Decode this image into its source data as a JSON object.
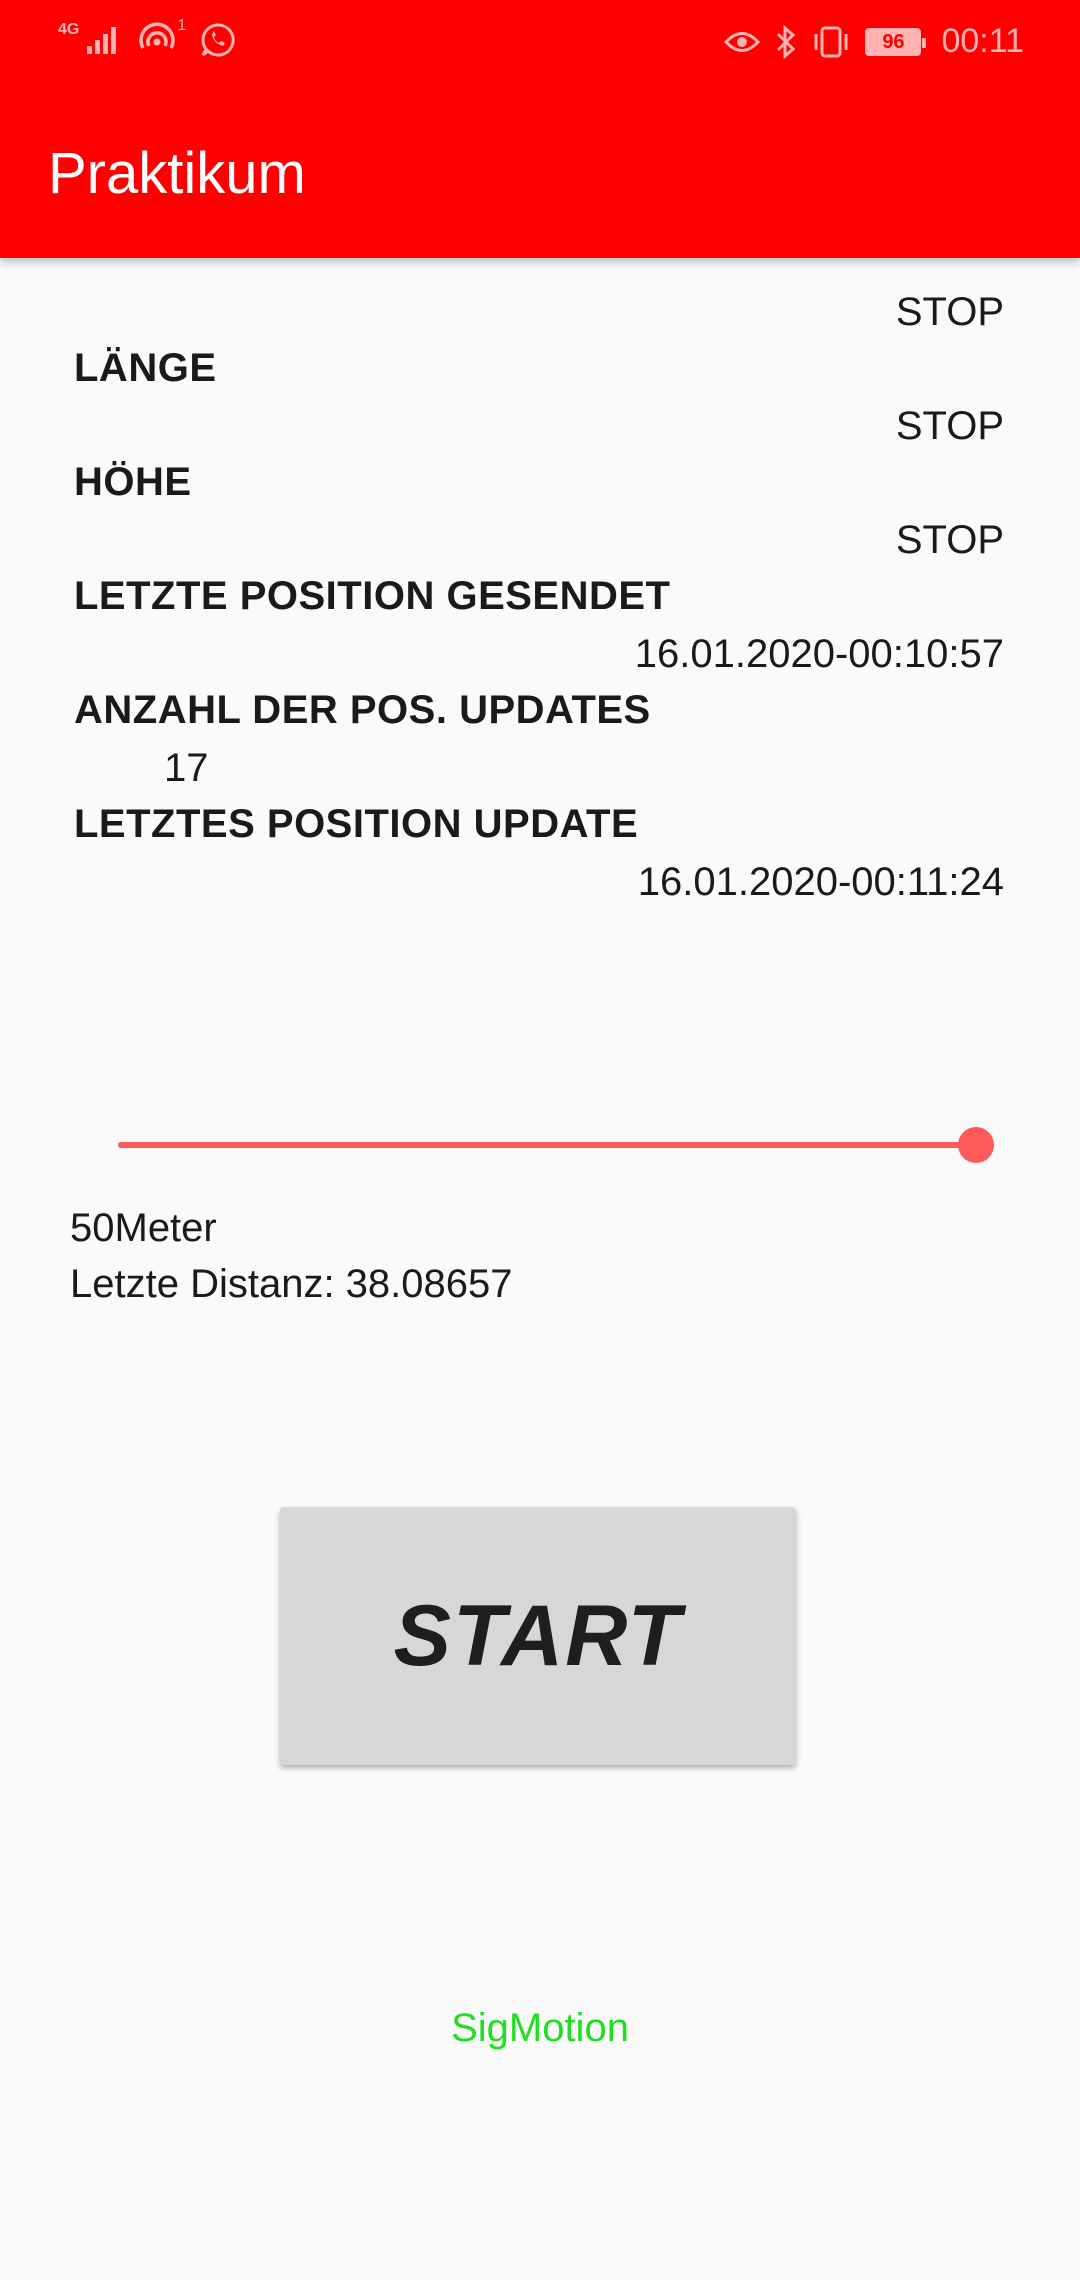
{
  "status_bar": {
    "network_label": "4G",
    "notification_count": "1",
    "battery_level": "96",
    "time": "00:11",
    "icons": [
      "signal-icon",
      "hotspot-icon",
      "whatsapp-icon",
      "eye-comfort-icon",
      "bluetooth-icon",
      "vibrate-icon",
      "battery-icon"
    ]
  },
  "app_bar": {
    "title": "Praktikum",
    "color": "#ff0000"
  },
  "fields": {
    "value_1": "STOP",
    "laenge_label": "LÄNGE",
    "laenge_value": "STOP",
    "hoehe_label": "HÖHE",
    "hoehe_value": "STOP",
    "last_sent_label": "LETZTE POSITION GESENDET",
    "last_sent_value": "16.01.2020-00:10:57",
    "update_count_label": "ANZAHL DER POS. UPDATES",
    "update_count_value": "17",
    "last_update_label": "LETZTES POSITION UPDATE",
    "last_update_value": "16.01.2020-00:11:24"
  },
  "slider": {
    "value_fraction": 1.0,
    "color": "#ff5a5a"
  },
  "distance": {
    "setting": "50Meter",
    "last_distance": "Letzte Distanz: 38.08657"
  },
  "start_button_label": "START",
  "footer_text": "SigMotion",
  "footer_color": "#22dd22"
}
